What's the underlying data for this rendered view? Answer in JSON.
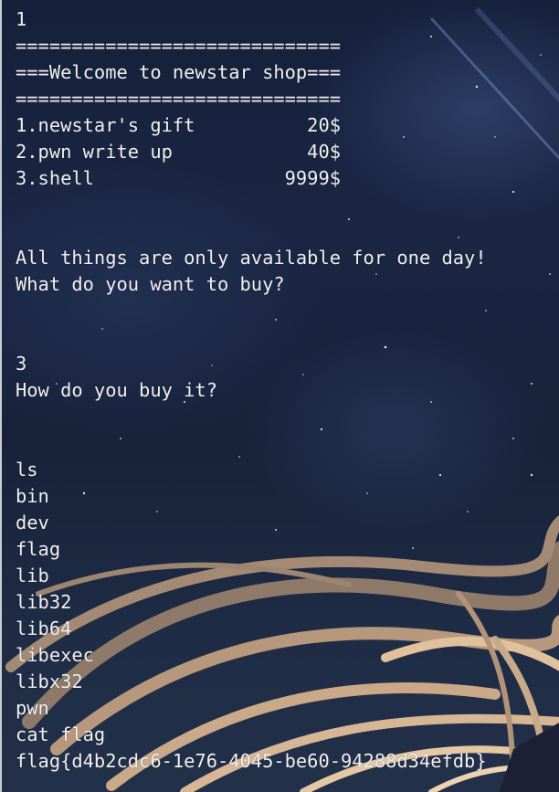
{
  "terminal": {
    "lines": [
      "1",
      "=============================",
      "===Welcome to newstar shop===",
      "=============================",
      "1.newstar's gift          20$",
      "2.pwn write up            40$",
      "3.shell                 9999$",
      "",
      "",
      "All things are only available for one day!",
      "What do you want to buy?",
      "",
      "",
      "3",
      "How do you buy it?",
      "",
      "",
      "ls",
      "bin",
      "dev",
      "flag",
      "lib",
      "lib32",
      "lib64",
      "libexec",
      "libx32",
      "pwn",
      "cat flag",
      "flag{d4b2cdc6-1e76-4045-be60-94288d34efdb}"
    ]
  }
}
